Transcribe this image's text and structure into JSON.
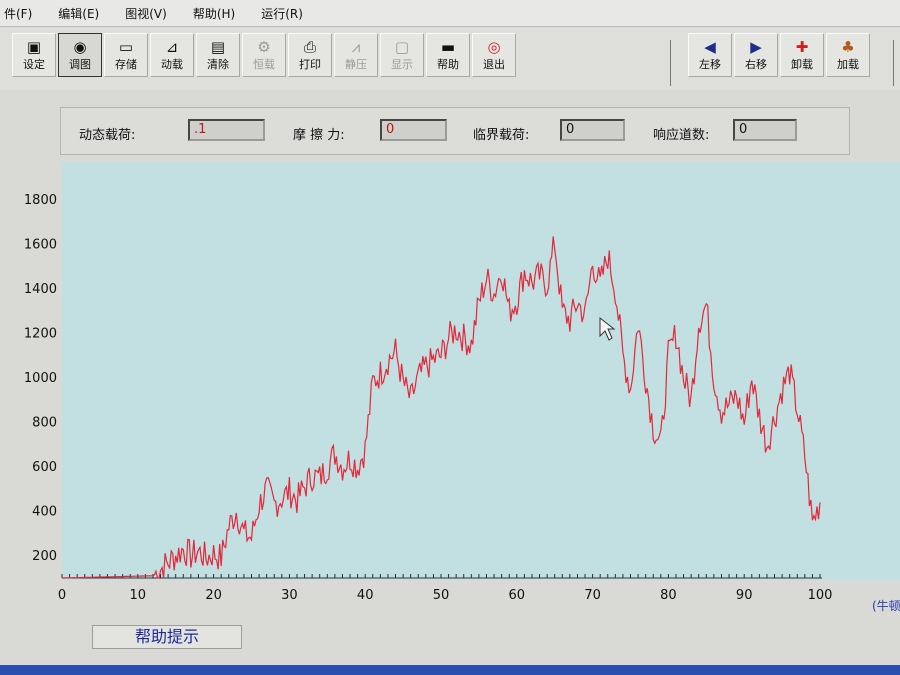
{
  "menu": [
    "件(F)",
    "编辑(E)",
    "图视(V)",
    "帮助(H)",
    "运行(R)"
  ],
  "toolbar_left": [
    {
      "label": "设定",
      "icon": "▣",
      "state": "normal"
    },
    {
      "label": "调图",
      "icon": "◉",
      "state": "active"
    },
    {
      "label": "存储",
      "icon": "▭",
      "state": "normal"
    },
    {
      "label": "动载",
      "icon": "⊿",
      "state": "normal"
    },
    {
      "label": "清除",
      "icon": "▤",
      "state": "normal"
    },
    {
      "label": "恒载",
      "icon": "⚙",
      "state": "disabled"
    },
    {
      "label": "打印",
      "icon": "⎙",
      "state": "normal"
    },
    {
      "label": "静压",
      "icon": "⩘",
      "state": "disabled"
    },
    {
      "label": "显示",
      "icon": "▢",
      "state": "disabled"
    },
    {
      "label": "帮助",
      "icon": "▬",
      "state": "normal"
    },
    {
      "label": "退出",
      "icon": "◎",
      "state": "normal"
    }
  ],
  "toolbar_right": [
    {
      "label": "左移",
      "icon": "◀"
    },
    {
      "label": "右移",
      "icon": "▶"
    },
    {
      "label": "卸载",
      "icon": "✚"
    },
    {
      "label": "加载",
      "icon": "♣"
    }
  ],
  "params": {
    "dynamic_load_label": "动态载荷:",
    "dynamic_load_value": ".1",
    "friction_label": "摩 擦 力:",
    "friction_value": "0",
    "critical_load_label": "临界载荷:",
    "critical_load_value": "0",
    "response_label": "响应道数:",
    "response_value": "0"
  },
  "help_hint": "帮助提示",
  "colors": {
    "plot_bg": "#c2e0e2",
    "line": "#e2283a"
  },
  "chart_data": {
    "type": "line",
    "xlim": [
      0,
      100
    ],
    "ylim": [
      100,
      1900
    ],
    "y_ticks": [
      200,
      400,
      600,
      800,
      1000,
      1200,
      1400,
      1600,
      1800
    ],
    "x_ticks": [
      0,
      10,
      20,
      30,
      40,
      50,
      60,
      70,
      80,
      90,
      100
    ],
    "x_unit_label": "(牛顿",
    "series": [
      {
        "x": [
          0,
          12,
          13,
          14,
          15,
          16,
          17,
          18,
          19,
          20,
          21,
          22,
          23,
          24,
          25,
          26,
          27,
          28,
          29,
          30,
          31,
          32,
          33,
          34,
          35,
          36,
          37,
          38,
          39,
          40,
          41,
          42,
          43,
          44,
          45,
          46,
          47,
          48,
          49,
          50,
          51,
          52,
          53,
          54,
          55,
          56,
          57,
          58,
          59,
          60,
          61,
          62,
          63,
          64,
          65,
          66,
          67,
          68,
          69,
          70,
          71,
          72,
          73,
          74,
          75,
          76,
          77,
          78,
          79,
          80,
          81,
          82,
          83,
          84,
          85,
          86,
          87,
          88,
          89,
          90,
          91,
          92,
          93,
          94,
          95,
          96,
          97,
          98,
          99,
          100
        ],
        "y": [
          100,
          110,
          140,
          170,
          200,
          230,
          200,
          220,
          190,
          210,
          190,
          330,
          400,
          300,
          280,
          430,
          500,
          430,
          460,
          490,
          450,
          510,
          560,
          550,
          600,
          660,
          600,
          640,
          600,
          680,
          980,
          1020,
          1080,
          1120,
          980,
          900,
          1000,
          1050,
          1080,
          1100,
          1180,
          1220,
          1180,
          1150,
          1340,
          1450,
          1380,
          1490,
          1300,
          1350,
          1480,
          1430,
          1460,
          1420,
          1610,
          1300,
          1260,
          1340,
          1280,
          1520,
          1420,
          1550,
          1400,
          1100,
          950,
          1250,
          1000,
          780,
          700,
          1100,
          1200,
          1000,
          900,
          1250,
          1330,
          1000,
          850,
          880,
          920,
          800,
          1000,
          830,
          700,
          820,
          950,
          1030,
          860,
          650,
          350,
          440
        ]
      }
    ]
  }
}
